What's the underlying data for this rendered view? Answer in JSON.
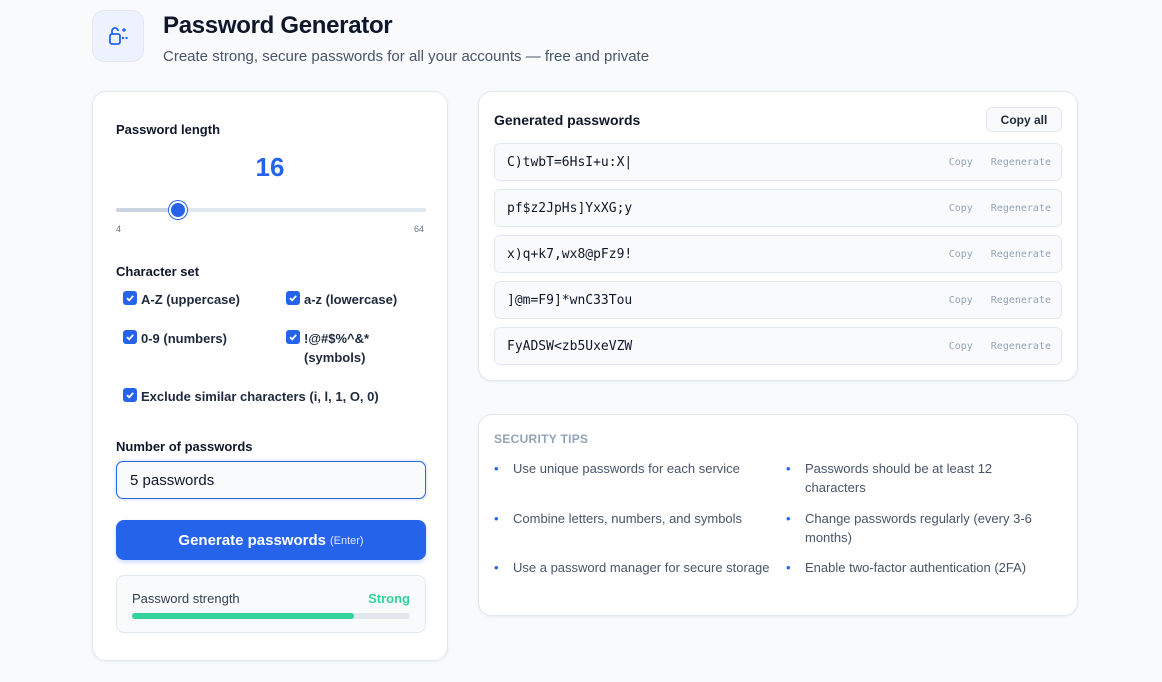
{
  "header": {
    "title": "Password Generator",
    "subtitle": "Create strong, secure passwords for all your accounts — free and private"
  },
  "settings": {
    "length_label": "Password length",
    "length_value": 16,
    "length_min": 4,
    "length_max": 64,
    "charset_label": "Character set",
    "options": [
      {
        "label": "A-Z (uppercase)",
        "checked": true
      },
      {
        "label": "a-z (lowercase)",
        "checked": true
      },
      {
        "label": "0-9 (numbers)",
        "checked": true
      },
      {
        "label": "!@#$%^&* (symbols)",
        "checked": true
      },
      {
        "label": "Exclude similar characters (i, l, 1, O, 0)",
        "checked": true
      }
    ],
    "count_label": "Number of passwords",
    "count_value": "5 passwords",
    "generate_label": "Generate passwords",
    "generate_hint": "(Enter)",
    "strength_label": "Password strength",
    "strength_value": "Strong",
    "strength_fraction": 0.8
  },
  "results": {
    "title": "Generated passwords",
    "copy_all_label": "Copy all",
    "copy_label": "Copy",
    "regenerate_label": "Regenerate",
    "passwords": [
      "C)twbT=6HsI+u:X|",
      "pf$z2JpHs]YxXG;y",
      "x)q+k7,wx8@pFz9!",
      "]@m=F9]*wnC33Tou",
      "FyADSW<zb5UxeVZW"
    ]
  },
  "tips": {
    "title": "SECURITY TIPS",
    "items": [
      "Use unique passwords for each service",
      "Passwords should be at least 12 characters",
      "Combine letters, numbers, and symbols",
      "Change passwords regularly (every 3-6 months)",
      "Use a password manager for secure storage",
      "Enable two-factor authentication (2FA)"
    ]
  },
  "colors": {
    "accent": "#2563eb",
    "strength": "#34d399"
  }
}
